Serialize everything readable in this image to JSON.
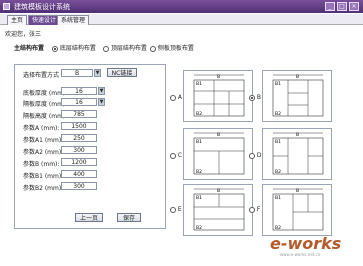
{
  "window": {
    "title": "建筑模板设计系统"
  },
  "tabs": [
    {
      "label": "主页",
      "active": false
    },
    {
      "label": "快速设计",
      "active": true
    },
    {
      "label": "系统管理",
      "active": false
    }
  ],
  "welcome": "欢迎您，张三",
  "structure": {
    "label": "主结构布置",
    "options": [
      "底层结构布置",
      "顶层结构布置",
      "侧板顶板布置"
    ],
    "selected_index": 0
  },
  "form": {
    "layout_label": "选择布置方式",
    "layout_value": "B",
    "match_button": "NC链接",
    "fields": [
      {
        "label": "底板厚度 (mm):",
        "value": "16",
        "dropdown": true
      },
      {
        "label": "隔板厚度 (mm):",
        "value": "16",
        "dropdown": true
      },
      {
        "label": "隔板高度 (mm):",
        "value": "785",
        "dropdown": false
      },
      {
        "label": "参数A (mm):",
        "value": "1500",
        "dropdown": false
      },
      {
        "label": "参数A1 (mm):",
        "value": "250",
        "dropdown": false
      },
      {
        "label": "参数A2 (mm):",
        "value": "300",
        "dropdown": false
      },
      {
        "label": "参数B (mm):",
        "value": "1200",
        "dropdown": false
      },
      {
        "label": "参数B1 (mm):",
        "value": "400",
        "dropdown": false
      },
      {
        "label": "参数B2 (mm):",
        "value": "300",
        "dropdown": false
      }
    ],
    "prev_button": "上一页",
    "save_button": "保存"
  },
  "layouts": [
    {
      "option": "A",
      "selected": false
    },
    {
      "option": "B",
      "selected": true
    },
    {
      "option": "C",
      "selected": false
    },
    {
      "option": "D",
      "selected": false
    },
    {
      "option": "E",
      "selected": false
    },
    {
      "option": "F",
      "selected": false
    }
  ],
  "diagram_labels": {
    "top": "B",
    "mid": "B1",
    "bottom": "B2"
  },
  "watermark": {
    "text": "e-works",
    "sub": "www.e-works.net.cn"
  }
}
